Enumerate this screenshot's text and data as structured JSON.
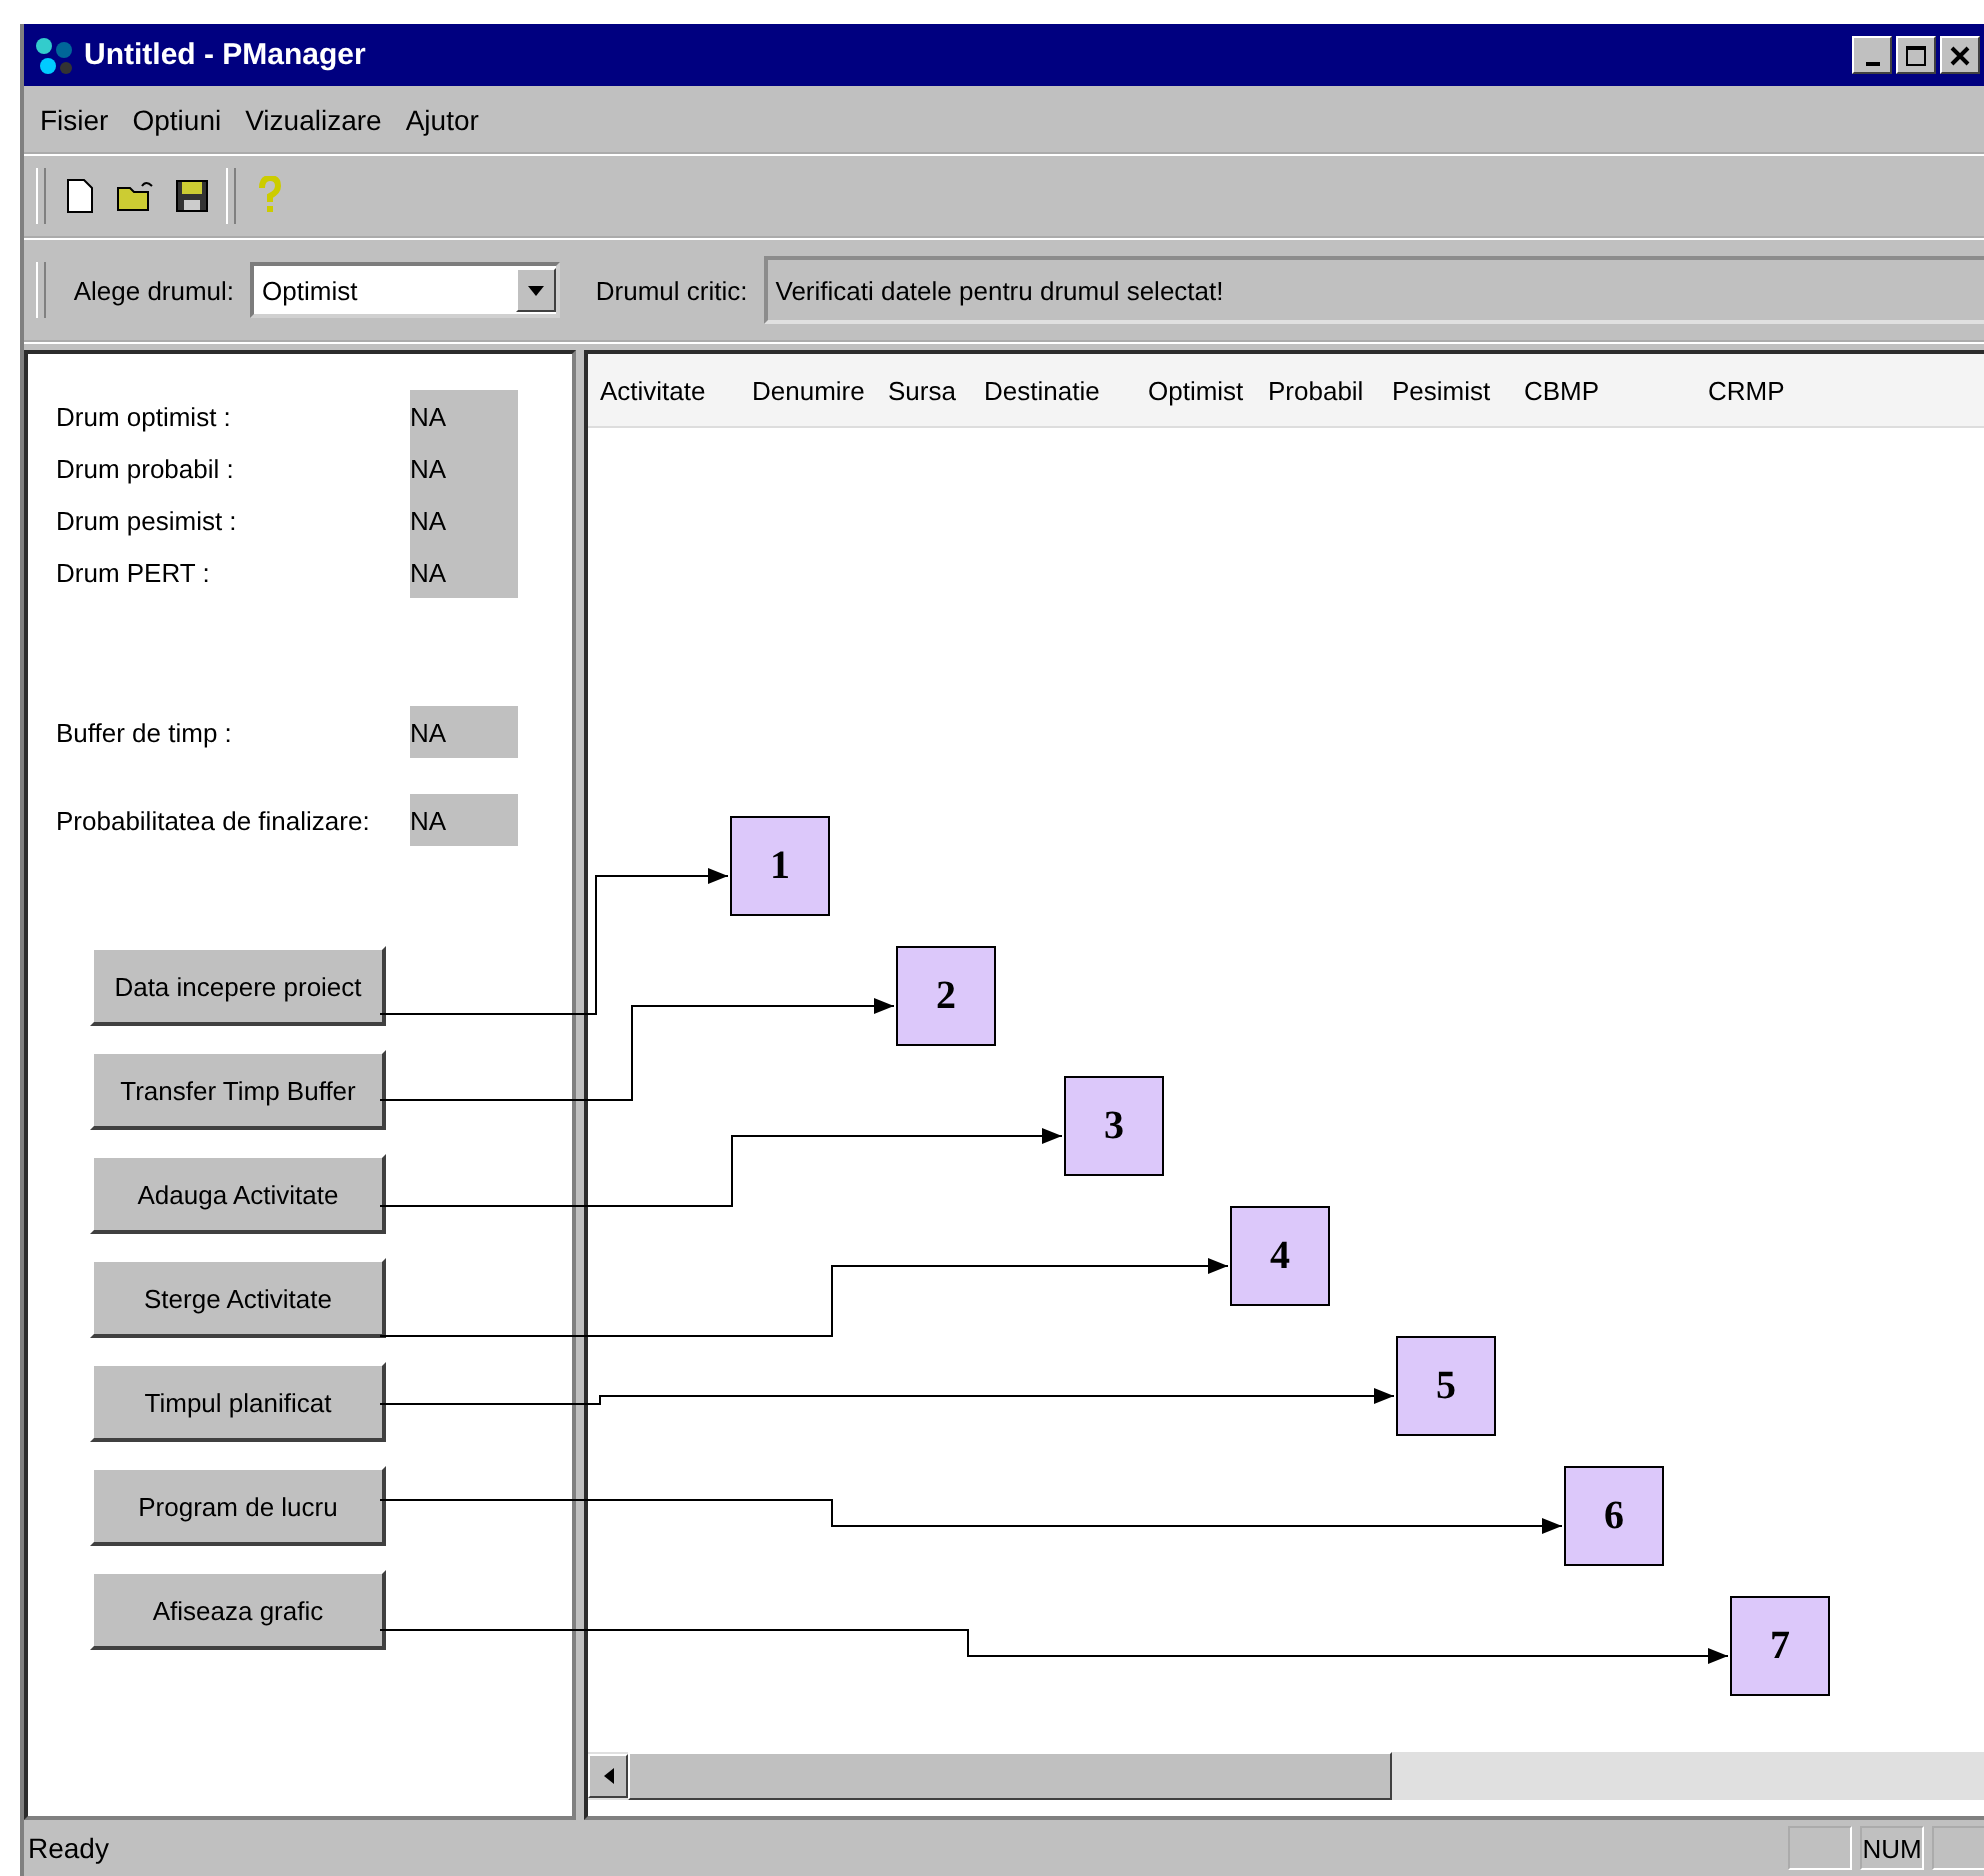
{
  "window": {
    "title": "Untitled - PManager"
  },
  "menu": [
    "Fisier",
    "Optiuni",
    "Vizualizare",
    "Ajutor"
  ],
  "path_selector": {
    "label": "Alege drumul:",
    "value": "Optimist"
  },
  "critical_path": {
    "label": "Drumul critic:",
    "value": "Verificati datele pentru drumul selectat!"
  },
  "summary": [
    {
      "label": "Drum optimist  :",
      "value": "NA"
    },
    {
      "label": "Drum probabil  :",
      "value": "NA"
    },
    {
      "label": "Drum pesimist  :",
      "value": "NA"
    },
    {
      "label": "Drum PERT  :",
      "value": "NA"
    }
  ],
  "buffer": {
    "label": "Buffer de timp  :",
    "value": "NA"
  },
  "probability": {
    "label": "Probabilitatea de finalizare:",
    "value": "NA"
  },
  "buttons": [
    "Data incepere proiect",
    "Transfer Timp Buffer",
    "Adauga Activitate",
    "Sterge Activitate",
    "Timpul planificat",
    "Program de lucru",
    "Afiseaza grafic"
  ],
  "table": {
    "columns": [
      "Activitate",
      "Denumire",
      "Sursa",
      "Destinatie",
      "Optimist",
      "Probabil",
      "Pesimist",
      "CBMP",
      "CRMP"
    ]
  },
  "callouts": [
    "1",
    "2",
    "3",
    "4",
    "5",
    "6",
    "7"
  ],
  "status_bar": {
    "text": "Ready",
    "indicator": "NUM"
  }
}
